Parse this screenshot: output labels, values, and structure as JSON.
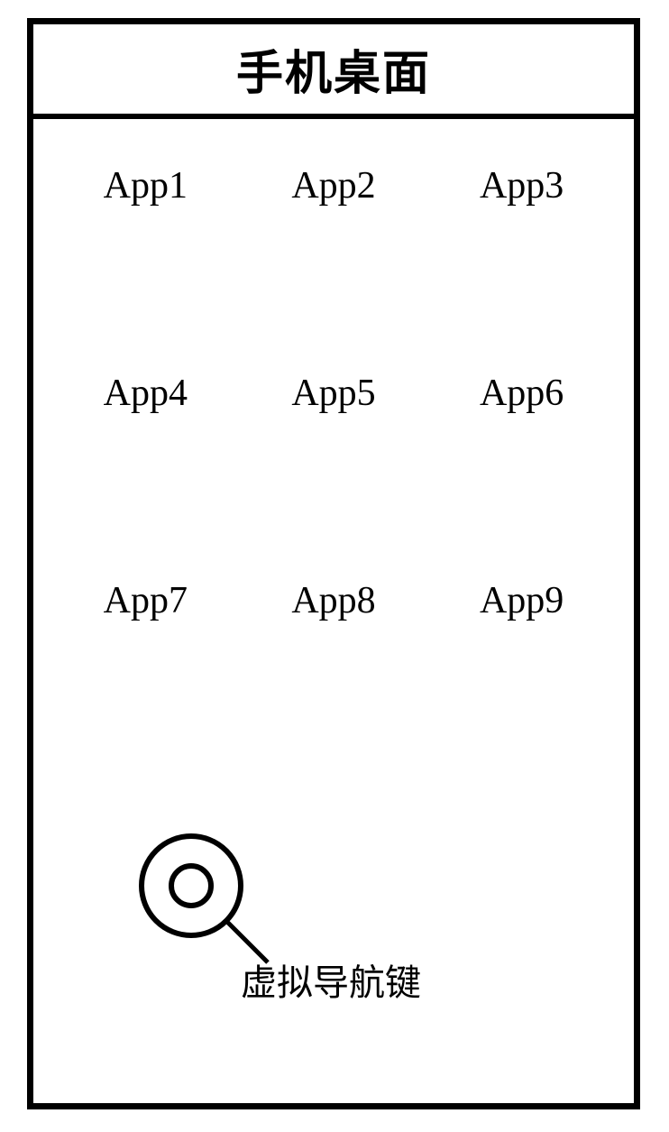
{
  "header": {
    "title": "手机桌面"
  },
  "apps": {
    "row1": [
      "App1",
      "App2",
      "App3"
    ],
    "row2": [
      "App4",
      "App5",
      "App6"
    ],
    "row3": [
      "App7",
      "App8",
      "App9"
    ]
  },
  "navkey": {
    "label": "虚拟导航键"
  }
}
